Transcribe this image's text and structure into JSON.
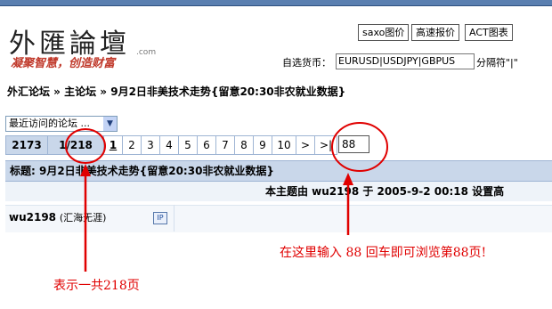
{
  "header": {
    "logo_text": "外匯論壇",
    "logo_suffix": ".com",
    "slogan": "凝聚智慧，创造财富",
    "buttons": [
      "saxo图价",
      "高速报价",
      "ACT图表"
    ],
    "currency_label": "自选货币：",
    "currency_value": "EURUSD|USDJPY|GBPUS",
    "currency_extra": "分隔符\"|\""
  },
  "breadcrumb": "外汇论坛 » 主论坛 » 9月2日非美技术走势{留意20:30非农就业数据}",
  "forum_select": {
    "selected": "最近访问的论坛 ..."
  },
  "pager": {
    "total": "2173",
    "page_info": "1/218",
    "pages": [
      "1",
      "2",
      "3",
      "4",
      "5",
      "6",
      "7",
      "8",
      "9",
      "10",
      ">",
      ">|"
    ],
    "current": "1",
    "input_value": "88"
  },
  "thread": {
    "title": "标题: 9月2日非美技术走势{留意20:30非农就业数据}",
    "meta": "本主题由 wu2198 于 2005-9-2 00:18 设置高",
    "author": "wu2198",
    "author_title": "(汇海无涯)",
    "ip_badge": "IP"
  },
  "annotations": {
    "right_note": "在这里输入 88 回车即可浏览第88页!",
    "left_note": "表示一共218页"
  },
  "colors": {
    "annotation": "#e00000",
    "header_bar": "#c9d7ea"
  }
}
